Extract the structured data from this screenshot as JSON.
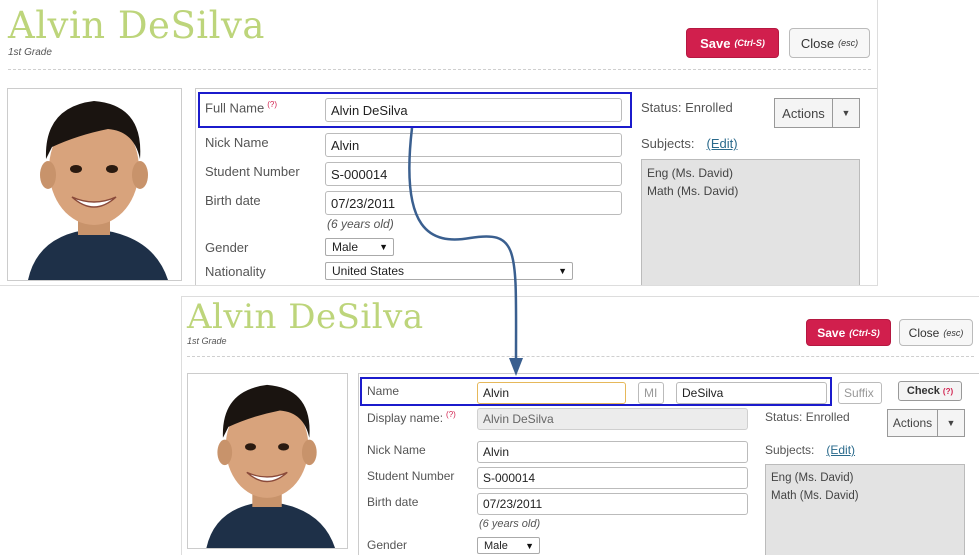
{
  "top": {
    "student_name": "Alvin DeSilva",
    "grade": "1st Grade",
    "save_label": "Save",
    "save_hint": "(Ctrl-S)",
    "close_label": "Close",
    "close_hint": "(esc)",
    "full_name_label": "Full Name",
    "required_marker": "(?)",
    "full_name_value": "Alvin DeSilva",
    "nick_name_label": "Nick Name",
    "nick_name_value": "Alvin",
    "student_number_label": "Student Number",
    "student_number_value": "S-000014",
    "birth_date_label": "Birth date",
    "birth_date_value": "07/23/2011",
    "age_text": "(6 years old)",
    "gender_label": "Gender",
    "gender_value": "Male",
    "nationality_label": "Nationality",
    "nationality_value": "United States",
    "status_text": "Status: Enrolled",
    "actions_label": "Actions",
    "subjects_label": "Subjects:",
    "edit_label": "(Edit)",
    "subjects": [
      "Eng   (Ms. David)",
      "Math   (Ms. David)"
    ]
  },
  "bottom": {
    "student_name": "Alvin DeSilva",
    "grade": "1st Grade",
    "save_label": "Save",
    "save_hint": "(Ctrl-S)",
    "close_label": "Close",
    "close_hint": "(esc)",
    "name_label": "Name",
    "first_name_value": "Alvin",
    "mi_placeholder": "MI",
    "last_name_value": "DeSilva",
    "suffix_placeholder": "Suffix",
    "check_label": "Check",
    "required_marker": "(?)",
    "display_name_label": "Display name:",
    "display_name_value": "Alvin DeSilva",
    "nick_name_label": "Nick Name",
    "nick_name_value": "Alvin",
    "student_number_label": "Student Number",
    "student_number_value": "S-000014",
    "birth_date_label": "Birth date",
    "birth_date_value": "07/23/2011",
    "age_text": "(6 years old)",
    "gender_label": "Gender",
    "gender_value": "Male",
    "status_text": "Status: Enrolled",
    "actions_label": "Actions",
    "subjects_label": "Subjects:",
    "edit_label": "(Edit)",
    "subjects": [
      "Eng   (Ms. David)",
      "Math   (Ms. David)"
    ]
  },
  "colors": {
    "name_green": "#bdd57b",
    "save_red": "#d11f4d",
    "highlight_blue": "#1b1bcc",
    "arrow_blue": "#3a5f8f"
  },
  "icons": {
    "photo": "student-photo",
    "dropdown": "caret-down-icon",
    "connector": "arrow-connector"
  }
}
